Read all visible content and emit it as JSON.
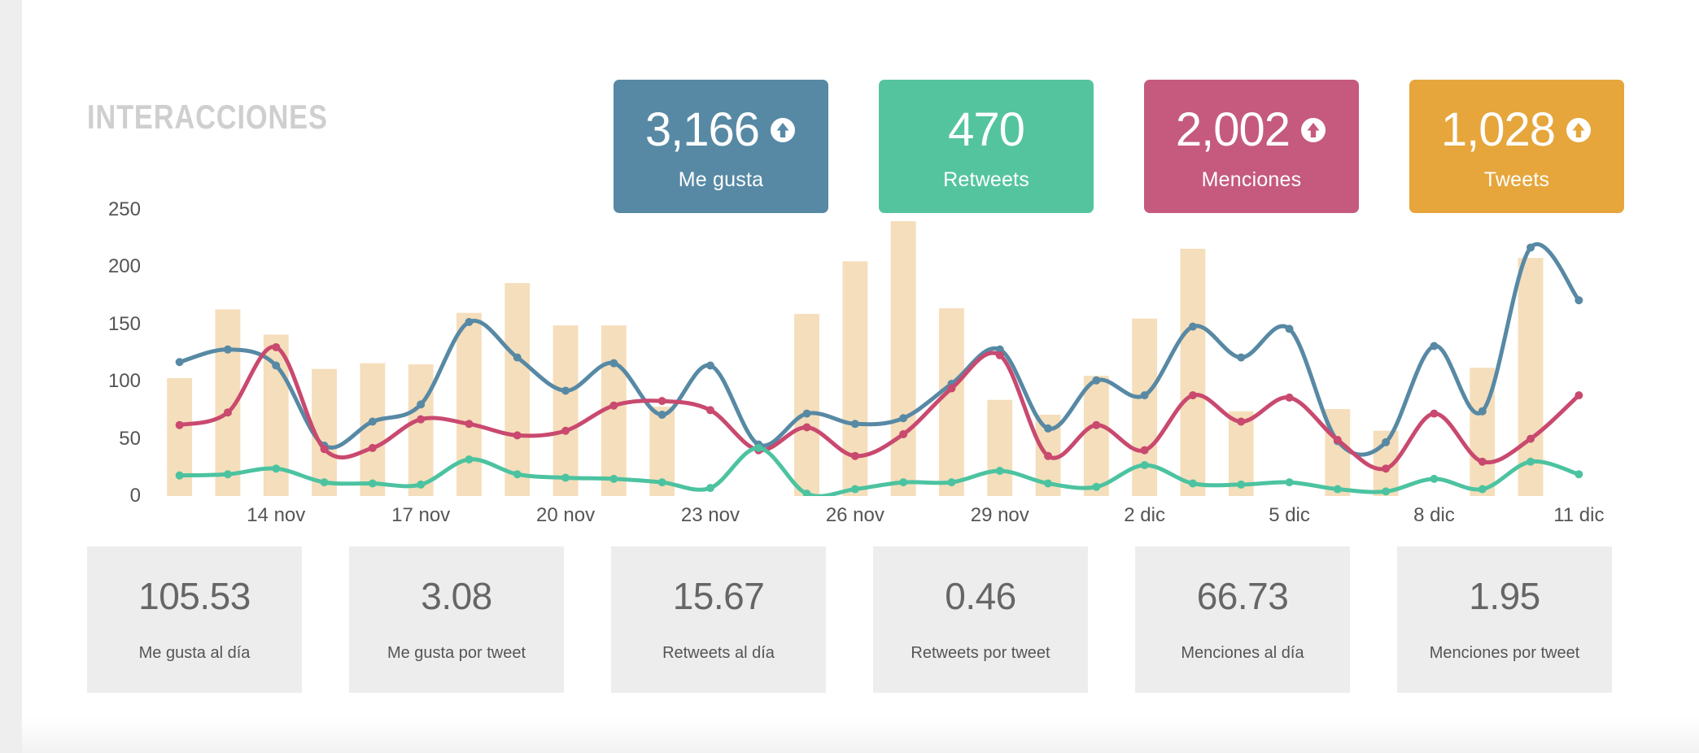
{
  "section": {
    "title": "INTERACCIONES"
  },
  "kpis": [
    {
      "value": "3,166",
      "label": "Me gusta",
      "color": "#5789a4",
      "arrow": true,
      "icon": "arrow-up-circle-icon"
    },
    {
      "value": "470",
      "label": "Retweets",
      "color": "#54c49f",
      "arrow": false,
      "icon": ""
    },
    {
      "value": "2,002",
      "label": "Menciones",
      "color": "#c55a7e",
      "arrow": true,
      "icon": "arrow-up-circle-icon"
    },
    {
      "value": "1,028",
      "label": "Tweets",
      "color": "#e6a63c",
      "arrow": true,
      "icon": "arrow-up-circle-icon"
    }
  ],
  "stats": [
    {
      "value": "105.53",
      "label": "Me gusta al día"
    },
    {
      "value": "3.08",
      "label": "Me gusta por tweet"
    },
    {
      "value": "15.67",
      "label": "Retweets al día"
    },
    {
      "value": "0.46",
      "label": "Retweets por tweet"
    },
    {
      "value": "66.73",
      "label": "Menciones al día"
    },
    {
      "value": "1.95",
      "label": "Menciones por tweet"
    }
  ],
  "chart_data": {
    "type": "line",
    "title": "",
    "xlabel": "",
    "ylabel": "",
    "ylim": [
      0,
      250
    ],
    "yticks": [
      0,
      50,
      100,
      150,
      200,
      250
    ],
    "grid": false,
    "legend": "none",
    "colors": {
      "bars": "#f5debb",
      "me_gusta": "#5789a4",
      "menciones": "#c9496f",
      "retweets": "#4cc3a0"
    },
    "x": [
      "12 nov",
      "13 nov",
      "14 nov",
      "15 nov",
      "16 nov",
      "17 nov",
      "18 nov",
      "19 nov",
      "20 nov",
      "21 nov",
      "22 nov",
      "23 nov",
      "24 nov",
      "25 nov",
      "26 nov",
      "27 nov",
      "28 nov",
      "29 nov",
      "30 nov",
      "1 dic",
      "2 dic",
      "3 dic",
      "4 dic",
      "5 dic",
      "6 dic",
      "7 dic",
      "8 dic",
      "9 dic",
      "10 dic",
      "11 dic"
    ],
    "xtick_labels": [
      "14 nov",
      "17 nov",
      "20 nov",
      "23 nov",
      "26 nov",
      "29 nov",
      "2 dic",
      "5 dic",
      "8 dic",
      "11 dic"
    ],
    "xtick_indices": [
      2,
      5,
      8,
      11,
      14,
      17,
      20,
      23,
      26,
      29
    ],
    "series": [
      {
        "name": "Tweets",
        "type": "bar",
        "color": "#f5debb",
        "values": [
          103,
          163,
          141,
          111,
          116,
          115,
          160,
          186,
          149,
          149,
          78,
          0,
          0,
          159,
          205,
          240,
          164,
          84,
          71,
          105,
          155,
          216,
          74,
          0,
          76,
          57,
          0,
          112,
          208,
          0
        ]
      },
      {
        "name": "Me gusta",
        "type": "line",
        "color": "#5789a4",
        "values": [
          117,
          128,
          114,
          44,
          65,
          80,
          152,
          121,
          92,
          116,
          71,
          114,
          45,
          72,
          63,
          68,
          98,
          128,
          59,
          101,
          88,
          148,
          121,
          146,
          48,
          47,
          131,
          74,
          217,
          171
        ]
      },
      {
        "name": "Menciones",
        "type": "line",
        "color": "#c9496f",
        "values": [
          62,
          73,
          130,
          41,
          42,
          67,
          63,
          53,
          57,
          79,
          83,
          75,
          40,
          60,
          35,
          54,
          94,
          123,
          35,
          62,
          40,
          88,
          65,
          86,
          49,
          24,
          72,
          30,
          50,
          88
        ]
      },
      {
        "name": "Retweets",
        "type": "line",
        "color": "#4cc3a0",
        "values": [
          18,
          19,
          24,
          12,
          11,
          10,
          32,
          19,
          16,
          15,
          12,
          7,
          42,
          2,
          6,
          12,
          12,
          22,
          11,
          8,
          27,
          11,
          10,
          12,
          6,
          4,
          15,
          6,
          30,
          19
        ]
      }
    ]
  }
}
